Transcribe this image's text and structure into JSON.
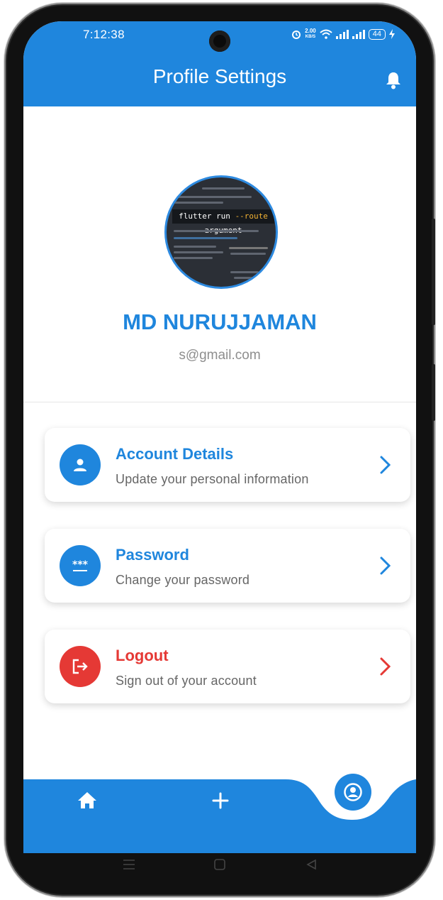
{
  "status_bar": {
    "time": "7:12:38",
    "speed_value": "2.00",
    "speed_unit": "KB/S",
    "battery": "44"
  },
  "app_bar": {
    "title": "Profile Settings",
    "notification_icon": "bell-icon"
  },
  "profile": {
    "name": "MD NURUJJAMAN",
    "email": "s@gmail.com",
    "avatar_caption_prefix": "flutter run ",
    "avatar_caption_highlight": "--route",
    "avatar_caption_suffix": " argument"
  },
  "menu": [
    {
      "title": "Account Details",
      "subtitle": "Update your personal information",
      "icon": "person-icon",
      "color": "#1f86dd"
    },
    {
      "title": "Password",
      "subtitle": "Change your password",
      "icon": "password-dots-icon",
      "color": "#1f86dd"
    },
    {
      "title": "Logout",
      "subtitle": "Sign out of your account",
      "icon": "logout-icon",
      "color": "#e53935"
    }
  ],
  "bottom_nav": {
    "items": [
      "home-icon",
      "add-icon",
      "account-circle-icon"
    ],
    "active": "account-circle-icon"
  },
  "colors": {
    "primary": "#1f86dd",
    "danger": "#e53935"
  }
}
